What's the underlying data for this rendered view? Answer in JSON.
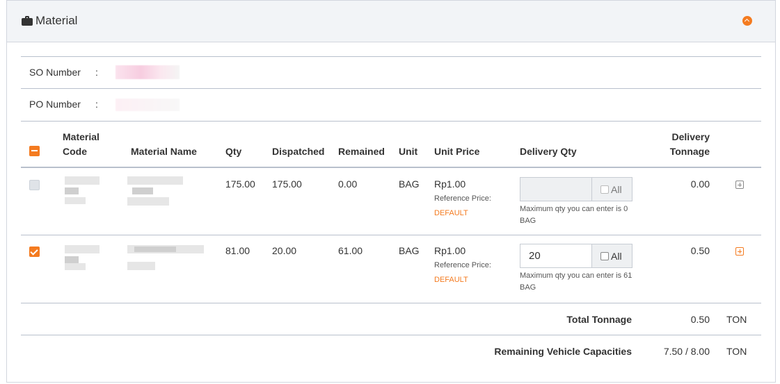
{
  "panel": {
    "title": "Material",
    "header_icon": "briefcase-icon",
    "collapse_icon": "chevron-up-icon"
  },
  "info": {
    "so_label": "SO Number",
    "po_label": "PO Number",
    "colon": ":"
  },
  "table": {
    "headers": {
      "material_code": "Material Code",
      "material_name": "Material Name",
      "qty": "Qty",
      "dispatched": "Dispatched",
      "remained": "Remained",
      "unit": "Unit",
      "unit_price": "Unit Price",
      "delivery_qty": "Delivery Qty",
      "delivery_tonnage": "Delivery Tonnage"
    },
    "rows": [
      {
        "checked": false,
        "qty": "175.00",
        "dispatched": "175.00",
        "remained": "0.00",
        "unit": "BAG",
        "unit_price": "Rp1.00",
        "reference_label": "Reference Price:",
        "reference_value": "DEFAULT",
        "delivery_qty_value": "",
        "all_label": "All",
        "hint": "Maximum qty you can enter is 0 BAG",
        "tonnage": "0.00"
      },
      {
        "checked": true,
        "qty": "81.00",
        "dispatched": "20.00",
        "remained": "61.00",
        "unit": "BAG",
        "unit_price": "Rp1.00",
        "reference_label": "Reference Price:",
        "reference_value": "DEFAULT",
        "delivery_qty_value": "20",
        "all_label": "All",
        "hint": "Maximum qty you can enter is 61 BAG",
        "tonnage": "0.50"
      }
    ]
  },
  "totals": {
    "total_tonnage_label": "Total Tonnage",
    "total_tonnage_value": "0.50",
    "total_tonnage_unit": "TON",
    "remaining_label": "Remaining Vehicle Capacities",
    "remaining_value": "7.50 / 8.00",
    "remaining_unit": "TON"
  },
  "colors": {
    "accent": "#f47b20",
    "header_bg": "#f2f4f7",
    "border": "#b8c0cc"
  }
}
